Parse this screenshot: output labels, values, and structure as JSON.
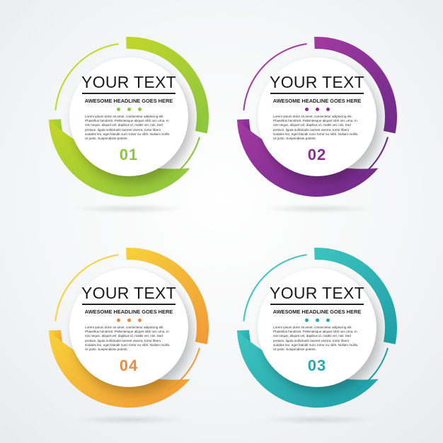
{
  "cards": [
    {
      "title": "YOUR TEXT",
      "headline": "AWESOME HEADLINE GOES HERE",
      "body": "Lorem ipsum dolor sit amet, consectetur adipiscing elit. Phasellus hendrerit. Pellentesque aliquet nibh nec urna. In nisi neque, aliquet vel, dapibus id, mattis vel, nisi. Sed pretium, ligula sollicitudin laoreet viverra, tortor libero sodales leo, eget blandit nunc tortor eu nibh. Nullam mollis. Ut justo. Suspendisse potenti.",
      "number": "01",
      "color_start": "#c3d629",
      "color_end": "#8cc63f",
      "number_color": "#8dc63f"
    },
    {
      "title": "YOUR TEXT",
      "headline": "AWESOME HEADLINE GOES HERE",
      "body": "Lorem ipsum dolor sit amet, consectetur adipiscing elit. Phasellus hendrerit. Pellentesque aliquet nibh nec urna. In nisi neque, aliquet vel, dapibus id, mattis vel, nisi. Sed pretium, ligula sollicitudin laoreet viverra, tortor libero sodales leo, eget blandit nunc tortor eu nibh. Nullam mollis. Ut justo. Suspendisse potenti.",
      "number": "02",
      "color_start": "#a33aa0",
      "color_end": "#6e2a8a",
      "number_color": "#8e2f8f"
    },
    {
      "title": "YOUR TEXT",
      "headline": "AWESOME HEADLINE GOES HERE",
      "body": "Lorem ipsum dolor sit amet, consectetur adipiscing elit. Phasellus hendrerit. Pellentesque aliquet nibh nec urna. In nisi neque, aliquet vel, dapibus id, mattis vel, nisi. Sed pretium, ligula sollicitudin laoreet viverra, tortor libero sodales leo, eget blandit nunc tortor eu nibh. Nullam mollis. Ut justo. Suspendisse potenti.",
      "number": "04",
      "color_start": "#f7d23a",
      "color_end": "#f19a37",
      "number_color": "#f08a3a"
    },
    {
      "title": "YOUR TEXT",
      "headline": "AWESOME HEADLINE GOES HERE",
      "body": "Lorem ipsum dolor sit amet, consectetur adipiscing elit. Phasellus hendrerit. Pellentesque aliquet nibh nec urna. In nisi neque, aliquet vel, dapibus id, mattis vel, nisi. Sed pretium, ligula sollicitudin laoreet viverra, tortor libero sodales leo, eget blandit nunc tortor eu nibh. Nullam mollis. Ut justo. Suspendisse potenti.",
      "number": "03",
      "color_start": "#3fc4c0",
      "color_end": "#1f9fa8",
      "number_color": "#27a9b0"
    }
  ]
}
